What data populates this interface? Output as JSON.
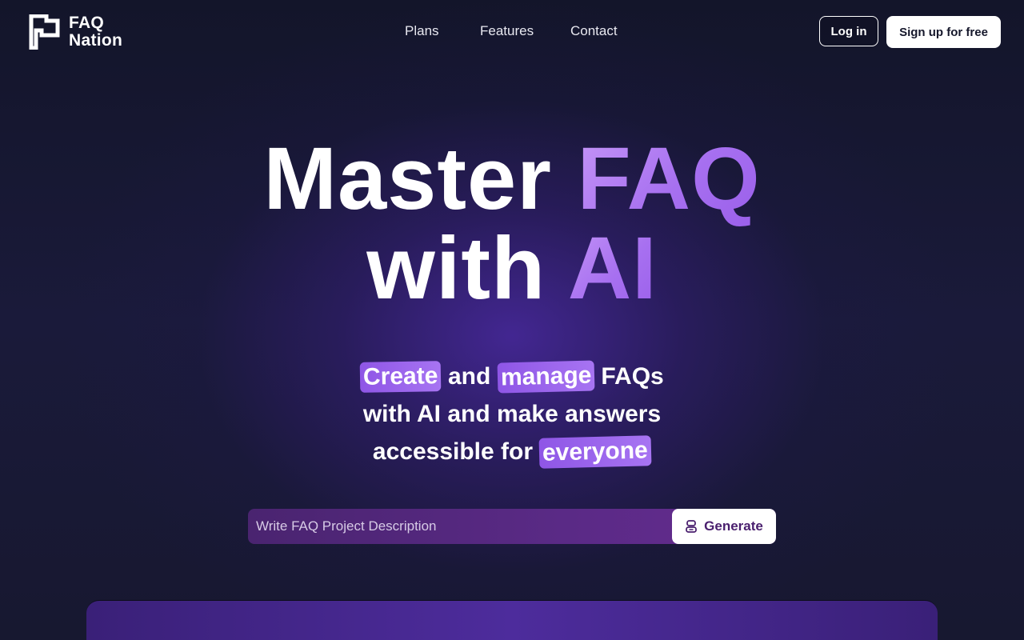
{
  "brand": {
    "line1": "FAQ",
    "line2": "Nation"
  },
  "nav": {
    "items": [
      {
        "label": "Plans"
      },
      {
        "label": "Features"
      },
      {
        "label": "Contact"
      }
    ]
  },
  "auth": {
    "login_label": "Log in",
    "signup_label": "Sign up for free"
  },
  "hero": {
    "title_word1": "Master",
    "title_word2": "FAQ",
    "title_word3": "with",
    "title_word4": "AI",
    "sub_create": "Create",
    "sub_and": "and",
    "sub_manage": "manage",
    "sub_faqs": "FAQs",
    "sub_line2": "with AI and make answers",
    "sub_accessible": "accessible for",
    "sub_everyone": "everyone"
  },
  "generator": {
    "placeholder": "Write FAQ Project Description",
    "button_label": "Generate"
  },
  "colors": {
    "accent": "#a770f0",
    "background": "#15172b",
    "highlight": "#9a62ec"
  },
  "icons": {
    "logo": "flag-logo-icon",
    "generate": "robot-icon"
  }
}
